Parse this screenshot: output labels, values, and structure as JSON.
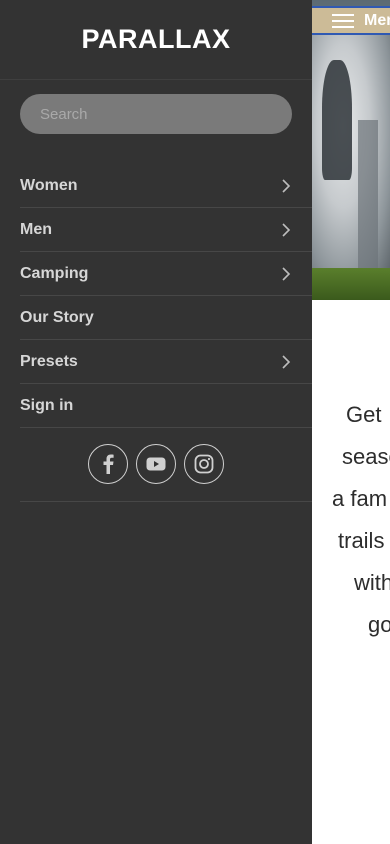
{
  "header": {
    "menu_label": "Menu"
  },
  "drawer": {
    "brand": "PARALLAX",
    "search": {
      "placeholder": "Search",
      "value": ""
    },
    "items": [
      {
        "label": "Women",
        "has_submenu": true
      },
      {
        "label": "Men",
        "has_submenu": true
      },
      {
        "label": "Camping",
        "has_submenu": true
      },
      {
        "label": "Our Story",
        "has_submenu": false
      },
      {
        "label": "Presets",
        "has_submenu": true
      },
      {
        "label": "Sign in",
        "has_submenu": false
      }
    ],
    "social": [
      "facebook-icon",
      "youtube-icon",
      "instagram-icon"
    ]
  },
  "content": {
    "text_lines": [
      "Get",
      "seaso",
      "a fam",
      "trails",
      "with",
      "go"
    ]
  },
  "colors": {
    "drawer_bg": "#333333",
    "menu_button_bg": "#ccbb97",
    "menu_button_border": "#2f59b3",
    "text_light": "#d6d6d6"
  }
}
